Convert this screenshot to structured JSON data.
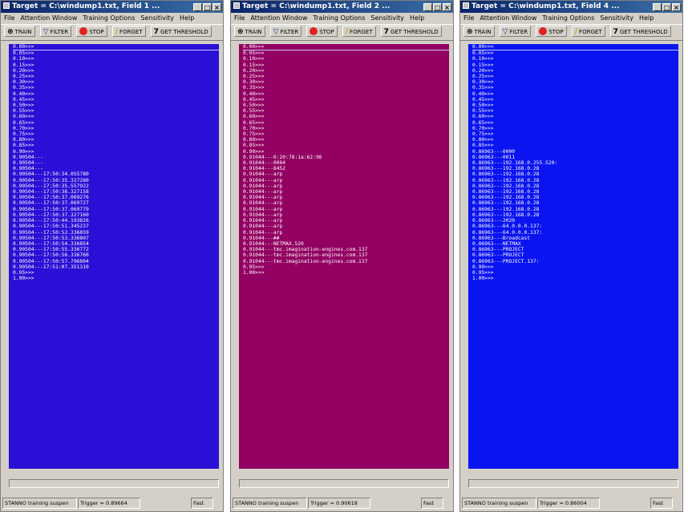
{
  "windows": [
    {
      "title": "Target = C:\\windump1.txt, Field 1 ...",
      "menu": [
        "File",
        "Attention Window",
        "Training Options",
        "Sensitivity",
        "Help"
      ],
      "toolbar": {
        "train": "TRAIN",
        "filter": "FILTER",
        "stop": "STOP",
        "forget": "FORGET",
        "threshold": "GET THRESHOLD"
      },
      "bg_color": "#2a0fd6",
      "rows": [
        "0.00>>>",
        "0.05>>>",
        "0.10>>>",
        "0.15>>>",
        "0.20>>>",
        "0.25>>>",
        "0.30>>>",
        "0.35>>>",
        "0.40>>>",
        "0.45>>>",
        "0.50>>>",
        "0.55>>>",
        "0.60>>>",
        "0.65>>>",
        "0.70>>>",
        "0.75>>>",
        "0.80>>>",
        "0.85>>>",
        "0.90>>>",
        "0.90504---",
        "0.90504---",
        "0.90504---",
        "0.90504---17:50:34.055780",
        "0.90504---17:50:35.327280",
        "0.90504---17:50:35.557922",
        "0.90504---17:50:36.327158",
        "0.90504---17:50:37.069276",
        "0.90504---17:50:37.069727",
        "0.90504---17:50:37.069779",
        "0.90504---17:50:37.327160",
        "0.90504---17:50:44.193826",
        "0.90504---17:50:51.345237",
        "0.90504---17:50:52.336859",
        "0.90504---17:50:53.336807",
        "0.90504---17:50:54.336854",
        "0.90504---17:50:55.336772",
        "0.90504---17:50:56.336760",
        "0.90504---17:50:57.796804",
        "0.90504---17:51:07.351310",
        "0.95>>>",
        "1.00>>>"
      ],
      "status": {
        "msg": "STANNO training suspen",
        "trigger": "Trigger = 0.89664",
        "speed": "Fast"
      }
    },
    {
      "title": "Target = C:\\windump1.txt, Field 2 ...",
      "menu": [
        "File",
        "Attention Window",
        "Training Options",
        "Sensitivity",
        "Help"
      ],
      "toolbar": {
        "train": "TRAIN",
        "filter": "FILTER",
        "stop": "STOP",
        "forget": "FORGET",
        "threshold": "GET THRESHOLD"
      },
      "bg_color": "#920062",
      "rows": [
        "0.00>>>",
        "0.05>>>",
        "0.10>>>",
        "0.15>>>",
        "0.20>>>",
        "0.25>>>",
        "0.30>>>",
        "0.35>>>",
        "0.40>>>",
        "0.45>>>",
        "0.50>>>",
        "0.55>>>",
        "0.60>>>",
        "0.65>>>",
        "0.70>>>",
        "0.75>>>",
        "0.80>>>",
        "0.85>>>",
        "0.90>>>",
        "0.91044---0:20:78:1a:62:96",
        "0.91044---0004",
        "0.91044---8452",
        "0.91044---arp",
        "0.91044---arp",
        "0.91044---arp",
        "0.91044---arp",
        "0.91044---arp",
        "0.91044---arp",
        "0.91044---arp",
        "0.91044---arp",
        "0.91044---arp",
        "0.91044---arp",
        "0.91044---arp",
        "0.91044---##",
        "0.91044---NETMAX.520",
        "0.91044---tmc.imagination-engines.com.137",
        "0.91044---tmc.imagination-engines.com.137",
        "0.91044---tmc.imagination-engines.com.137",
        "0.95>>>",
        "1.00>>>"
      ],
      "status": {
        "msg": "STANNO training suspen",
        "trigger": "Trigger = 0.90618",
        "speed": "Fast"
      }
    },
    {
      "title": "Target = C:\\windump1.txt, Field 4 ...",
      "menu": [
        "File",
        "Attention Window",
        "Training Options",
        "Sensitivity",
        "Help"
      ],
      "toolbar": {
        "train": "TRAIN",
        "filter": "FILTER",
        "stop": "STOP",
        "forget": "FORGET",
        "threshold": "GET THRESHOLD"
      },
      "bg_color": "#0a14f0",
      "rows": [
        "0.00>>>",
        "0.05>>>",
        "0.10>>>",
        "0.15>>>",
        "0.20>>>",
        "0.25>>>",
        "0.30>>>",
        "0.35>>>",
        "0.40>>>",
        "0.45>>>",
        "0.50>>>",
        "0.55>>>",
        "0.60>>>",
        "0.65>>>",
        "0.70>>>",
        "0.75>>>",
        "0.80>>>",
        "0.85>>>",
        "0.86963---0000",
        "0.86963---0011",
        "0.86963---192.168.0.255.520:",
        "0.86963---192.168.0.28",
        "0.86963---192.168.0.28",
        "0.86963---192.168.0.28",
        "0.86963---192.168.0.28",
        "0.86963---192.168.0.28",
        "0.86963---192.168.0.28",
        "0.86963---192.168.0.28",
        "0.86963---192.168.0.28",
        "0.86963---192.168.0.28",
        "0.86963---2020",
        "0.86963---64.0.0.0.137:",
        "0.86963---64.0.0.0.137:",
        "0.86963---Broadcast",
        "0.86963---NETMAX",
        "0.86963---PROJECT",
        "0.86963---PROJECT",
        "0.86963---PROJECT.137:",
        "0.90>>>",
        "0.95>>>",
        "1.00>>>"
      ],
      "status": {
        "msg": "STANNO training suspen",
        "trigger": "Trigger = 0.86004",
        "speed": "Fast"
      }
    }
  ]
}
